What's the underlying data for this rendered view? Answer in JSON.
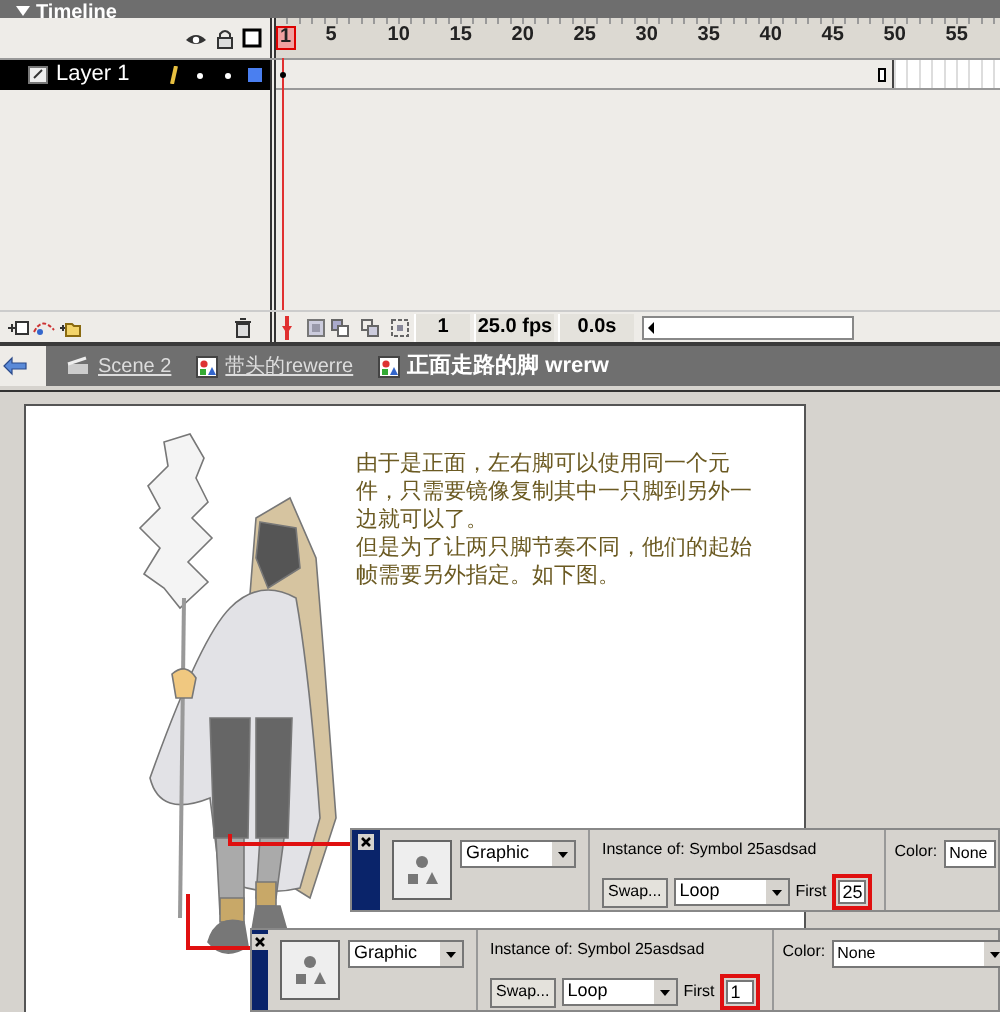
{
  "timeline": {
    "title": "Timeline",
    "frame_numbers": [
      "1",
      "5",
      "10",
      "15",
      "20",
      "25",
      "30",
      "35",
      "40",
      "45",
      "50",
      "55"
    ],
    "layers": [
      {
        "name": "Layer 1",
        "selected": true
      }
    ],
    "toolbar": {
      "frame": "1",
      "fps": "25.0 fps",
      "time": "0.0s"
    }
  },
  "breadcrumbs": [
    {
      "label": "Scene 2",
      "kind": "scene",
      "selected": false
    },
    {
      "label": "带头的rewerre",
      "kind": "symbol",
      "selected": false
    },
    {
      "label": "正面走路的脚 wrerw",
      "kind": "symbol",
      "selected": true
    }
  ],
  "stage": {
    "note": [
      "由于是正面，左右脚可以使用同一个元件，只需要镜像复制其中一只脚到另外一边就可以了。",
      "但是为了让两只脚节奏不同，他们的起始帧需要另外指定。如下图。"
    ]
  },
  "property_panels": [
    {
      "type": "Graphic",
      "instance_label": "Instance of:",
      "instance": "Symbol 25asdsad",
      "swap": "Swap...",
      "loop": "Loop",
      "first_label": "First",
      "first": "25",
      "color_label": "Color:",
      "color_effect": "None"
    },
    {
      "type": "Graphic",
      "instance_label": "Instance of:",
      "instance": "Symbol 25asdsad",
      "swap": "Swap...",
      "loop": "Loop",
      "first_label": "First",
      "first": "1",
      "color_label": "Color:",
      "color_effect": "None"
    }
  ]
}
